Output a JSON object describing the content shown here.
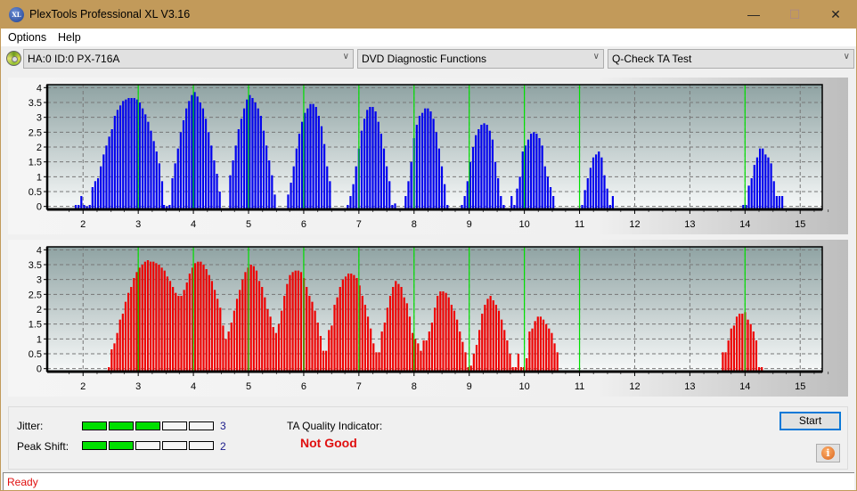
{
  "window": {
    "title": "PlexTools Professional XL V3.16",
    "icon_text": "XL",
    "controls": [
      "minimize-icon",
      "maximize-icon",
      "close-icon"
    ]
  },
  "menu": {
    "items": [
      "Options",
      "Help"
    ]
  },
  "toolbar": {
    "drive": "HA:0 ID:0  PX-716A",
    "function": "DVD Diagnostic Functions",
    "test": "Q-Check TA Test"
  },
  "chart_data": [
    {
      "type": "bar",
      "name": "jitter-distribution",
      "color": "#0000ee",
      "xlim": [
        1.35,
        15.4
      ],
      "ylim": [
        -0.1,
        4.1
      ],
      "yticks": [
        0,
        0.5,
        1,
        1.5,
        2,
        2.5,
        3,
        3.5,
        4
      ],
      "ytick_labels": [
        "0",
        "0.5",
        "1",
        "1.5",
        "2",
        "2.5",
        "3",
        "3.5",
        "4"
      ],
      "xticks": [
        2,
        3,
        4,
        5,
        6,
        7,
        8,
        9,
        10,
        11,
        12,
        13,
        14,
        15
      ],
      "xtick_labels": [
        "2",
        "3",
        "4",
        "5",
        "6",
        "7",
        "8",
        "9",
        "10",
        "11",
        "12",
        "13",
        "14",
        "15"
      ],
      "reference_lines": [
        3,
        4,
        5,
        6,
        7,
        8,
        9,
        10,
        11,
        14
      ],
      "clusters": [
        {
          "start": 1.85,
          "values": [
            0.05,
            0.05,
            0.35,
            0.05,
            0,
            0.05,
            0.65,
            0.85,
            0.95,
            1.35,
            1.75,
            2.05,
            2.35,
            2.6,
            3.05,
            3.25,
            3.4,
            3.55,
            3.6,
            3.65,
            3.65,
            3.65,
            3.6,
            3.5,
            3.3,
            3.1,
            2.85,
            2.55,
            2.2,
            1.85,
            1.45,
            0.85
          ]
        },
        {
          "start": 3.45,
          "values": [
            0.05,
            0,
            0.05,
            0.95,
            1.45,
            1.95,
            2.5,
            2.9,
            3.3,
            3.55,
            3.75,
            3.85,
            3.7,
            3.5,
            3.3,
            2.95,
            2.5,
            2.05,
            1.55,
            1.1,
            0.5
          ]
        },
        {
          "start": 4.65,
          "values": [
            1.05,
            1.55,
            2.05,
            2.6,
            2.95,
            3.3,
            3.6,
            3.75,
            3.65,
            3.5,
            3.3,
            3.05,
            2.55,
            2.05,
            1.55,
            1.05,
            0.4
          ]
        },
        {
          "start": 5.7,
          "values": [
            0.4,
            0.8,
            1.35,
            1.95,
            2.45,
            2.85,
            3.15,
            3.3,
            3.45,
            3.45,
            3.35,
            3.05,
            2.7,
            2.1,
            1.35,
            0.85
          ]
        },
        {
          "start": 6.78,
          "values": [
            0.05,
            0.35,
            0.75,
            1.35,
            1.95,
            2.55,
            2.95,
            3.25,
            3.35,
            3.35,
            3.2,
            2.85,
            2.45,
            1.95,
            1.35,
            0.85,
            0.05,
            0.1
          ]
        },
        {
          "start": 7.83,
          "values": [
            0.35,
            0.85,
            1.5,
            2.3,
            2.75,
            3.05,
            3.15,
            3.3,
            3.3,
            3.2,
            2.95,
            2.5,
            1.95,
            1.35,
            0.75,
            0.05
          ]
        },
        {
          "start": 8.85,
          "values": [
            0.05,
            0.35,
            0.85,
            1.5,
            2.0,
            2.4,
            2.6,
            2.75,
            2.8,
            2.75,
            2.55,
            2.25,
            1.5,
            0.95,
            0.35,
            0.05
          ]
        },
        {
          "start": 9.75,
          "values": [
            0.35,
            0.05,
            0.6,
            1.0,
            1.85,
            2.05,
            2.25,
            2.45,
            2.5,
            2.45,
            2.3,
            2.05,
            1.35,
            1.0,
            0.65,
            0.35
          ]
        },
        {
          "start": 11.03,
          "values": [
            0.05,
            0.55,
            0.95,
            1.3,
            1.65,
            1.75,
            1.85,
            1.65,
            1.05,
            0.6,
            0.05,
            0.35
          ]
        },
        {
          "start": 13.95,
          "values": [
            0.05,
            0.05,
            0.7,
            0.95,
            1.4,
            1.65,
            1.95,
            1.95,
            1.75,
            1.65,
            1.45,
            0.85,
            0.35,
            0.35,
            0.35
          ]
        }
      ]
    },
    {
      "type": "bar",
      "name": "peak-shift-distribution",
      "color": "#ee0000",
      "xlim": [
        1.35,
        15.4
      ],
      "ylim": [
        -0.1,
        4.1
      ],
      "yticks": [
        0,
        0.5,
        1,
        1.5,
        2,
        2.5,
        3,
        3.5,
        4
      ],
      "ytick_labels": [
        "0",
        "0.5",
        "1",
        "1.5",
        "2",
        "2.5",
        "3",
        "3.5",
        "4"
      ],
      "xticks": [
        2,
        3,
        4,
        5,
        6,
        7,
        8,
        9,
        10,
        11,
        12,
        13,
        14,
        15
      ],
      "xtick_labels": [
        "2",
        "3",
        "4",
        "5",
        "6",
        "7",
        "8",
        "9",
        "10",
        "11",
        "12",
        "13",
        "14",
        "15"
      ],
      "reference_lines": [
        3,
        4,
        5,
        6,
        7,
        8,
        9,
        10,
        11,
        14
      ],
      "clusters": [
        {
          "start": 2.45,
          "values": [
            0.05,
            0.65,
            0.85,
            1.2,
            1.65,
            1.85,
            2.25,
            2.55,
            2.75,
            3.05,
            3.25,
            3.4,
            3.5,
            3.6,
            3.65,
            3.6,
            3.6,
            3.55,
            3.5,
            3.4,
            3.3,
            3.1,
            2.95,
            2.75,
            2.55,
            2.45,
            2.45,
            2.65,
            2.9,
            3.2,
            3.4,
            3.55,
            3.6,
            3.6,
            3.5,
            3.35,
            3.15,
            2.95,
            2.65,
            2.35,
            2.05,
            1.45,
            1.0,
            1.25,
            1.55,
            1.95,
            2.35,
            2.65,
            3.0,
            3.25,
            3.4,
            3.5,
            3.45,
            3.3,
            2.95,
            2.75,
            2.4,
            2.0,
            1.75,
            1.4,
            1.2,
            1.5,
            1.95,
            2.45,
            2.85,
            3.15,
            3.25,
            3.3,
            3.3,
            3.25,
            3.05,
            2.75,
            2.45,
            2.25,
            1.95,
            1.55,
            1.1,
            0.6,
            0.6,
            1.3,
            1.45,
            2.15,
            2.4,
            2.75,
            3.0,
            3.1,
            3.2,
            3.2,
            3.15,
            3.05,
            2.8,
            2.45,
            2.15,
            1.75,
            1.35,
            0.85,
            0.55,
            0.55,
            1.25,
            1.55,
            2.05,
            2.45,
            2.75,
            2.95,
            2.85,
            2.75,
            2.4,
            2.2,
            1.75,
            1.2,
            1.0,
            0.85,
            0.6,
            0.95,
            0.95,
            1.25,
            1.55,
            2.05,
            2.45,
            2.6,
            2.6,
            2.55,
            2.4,
            2.15,
            1.95,
            1.65,
            1.25,
            0.9,
            0.55,
            0.05,
            0.1,
            0.5,
            0.8,
            1.3,
            1.85,
            2.15,
            2.35,
            2.45,
            2.3,
            2.15,
            1.95,
            1.65,
            1.3,
            0.95,
            0.5,
            0.05,
            0.05,
            0.5,
            0.05,
            0.05,
            0.35,
            1.25,
            1.35,
            1.6,
            1.75,
            1.75,
            1.65,
            1.5,
            1.35,
            1.2,
            0.85,
            0.55
          ]
        },
        {
          "start": 13.58,
          "values": [
            0.55,
            0.55,
            0.95,
            1.35,
            1.45,
            1.75,
            1.85,
            1.85,
            1.9,
            1.65,
            1.5,
            1.25,
            0.95,
            0.05,
            0.05
          ]
        }
      ]
    }
  ],
  "results": {
    "jitter": {
      "label": "Jitter:",
      "score": 3,
      "max": 5,
      "score_text": "3"
    },
    "peak_shift": {
      "label": "Peak Shift:",
      "score": 2,
      "max": 5,
      "score_text": "2"
    },
    "ta_quality_label": "TA Quality Indicator:",
    "ta_quality_value": "Not Good"
  },
  "buttons": {
    "start": "Start",
    "info_icon": "i"
  },
  "status": {
    "text": "Ready"
  },
  "colors": {
    "title_bar": "#c29a5a",
    "jitter_bars": "#0000ee",
    "peak_shift_bars": "#ee0000",
    "reference_line": "#00e000",
    "meter_on": "#00e000",
    "ta_bad": "#e01010"
  }
}
